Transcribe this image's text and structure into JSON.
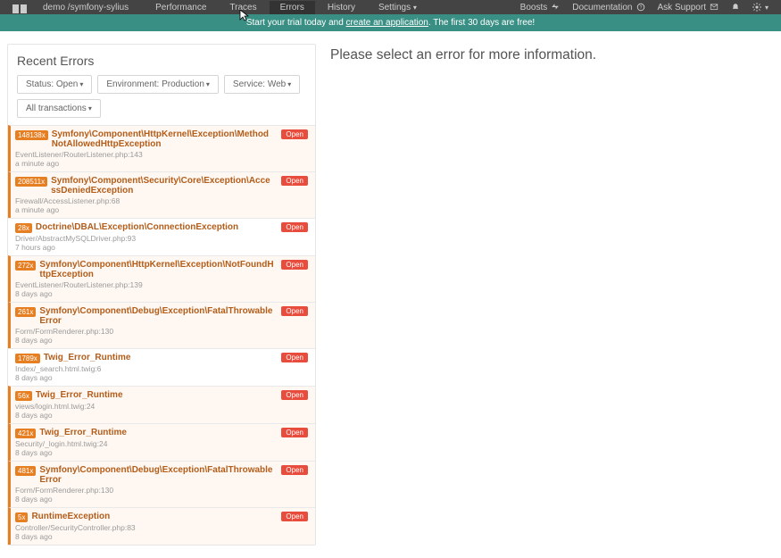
{
  "nav": {
    "logo": "logo",
    "breadcrumb": "demo /symfony-sylius",
    "items": [
      "Performance",
      "Traces",
      "Errors",
      "History",
      "Settings"
    ],
    "activeIndex": 2,
    "right": {
      "boosts": "Boosts",
      "docs": "Documentation",
      "support": "Ask Support"
    }
  },
  "banner": {
    "prefix": "Start your trial today and ",
    "link": "create an application",
    "suffix": ". The first 30 days are free!"
  },
  "panel": {
    "title": "Recent Errors",
    "filters": {
      "status": "Status: Open",
      "env": "Environment: Production",
      "service": "Service: Web",
      "txn": "All transactions"
    }
  },
  "rightPane": {
    "prompt": "Please select an error for more information."
  },
  "errors": [
    {
      "count": "148138x",
      "title": "Symfony\\Component\\HttpKernel\\Exception\\MethodNotAllowedHttpException",
      "status": "Open",
      "file": "EventListener/RouterListener.php:143",
      "time": "a minute ago",
      "sel": true
    },
    {
      "count": "208511x",
      "title": "Symfony\\Component\\Security\\Core\\Exception\\AccessDeniedException",
      "status": "Open",
      "file": "Firewall/AccessListener.php:68",
      "time": "a minute ago",
      "sel": true
    },
    {
      "count": "28x",
      "title": "Doctrine\\DBAL\\Exception\\ConnectionException",
      "status": "Open",
      "file": "Driver/AbstractMySQLDriver.php:93",
      "time": "7 hours ago",
      "sel": false
    },
    {
      "count": "272x",
      "title": "Symfony\\Component\\HttpKernel\\Exception\\NotFoundHttpException",
      "status": "Open",
      "file": "EventListener/RouterListener.php:139",
      "time": "8 days ago",
      "sel": true
    },
    {
      "count": "261x",
      "title": "Symfony\\Component\\Debug\\Exception\\FatalThrowableError",
      "status": "Open",
      "file": "Form/FormRenderer.php:130",
      "time": "8 days ago",
      "sel": true
    },
    {
      "count": "1789x",
      "title": "Twig_Error_Runtime",
      "status": "Open",
      "file": "Index/_search.html.twig:6",
      "time": "8 days ago",
      "sel": false
    },
    {
      "count": "56x",
      "title": "Twig_Error_Runtime",
      "status": "Open",
      "file": "views/login.html.twig:24",
      "time": "8 days ago",
      "sel": true
    },
    {
      "count": "421x",
      "title": "Twig_Error_Runtime",
      "status": "Open",
      "file": "Security/_login.html.twig:24",
      "time": "8 days ago",
      "sel": true
    },
    {
      "count": "481x",
      "title": "Symfony\\Component\\Debug\\Exception\\FatalThrowableError",
      "status": "Open",
      "file": "Form/FormRenderer.php:130",
      "time": "8 days ago",
      "sel": true
    },
    {
      "count": "5x",
      "title": "RuntimeException",
      "status": "Open",
      "file": "Controller/SecurityController.php:83",
      "time": "8 days ago",
      "sel": true
    }
  ]
}
